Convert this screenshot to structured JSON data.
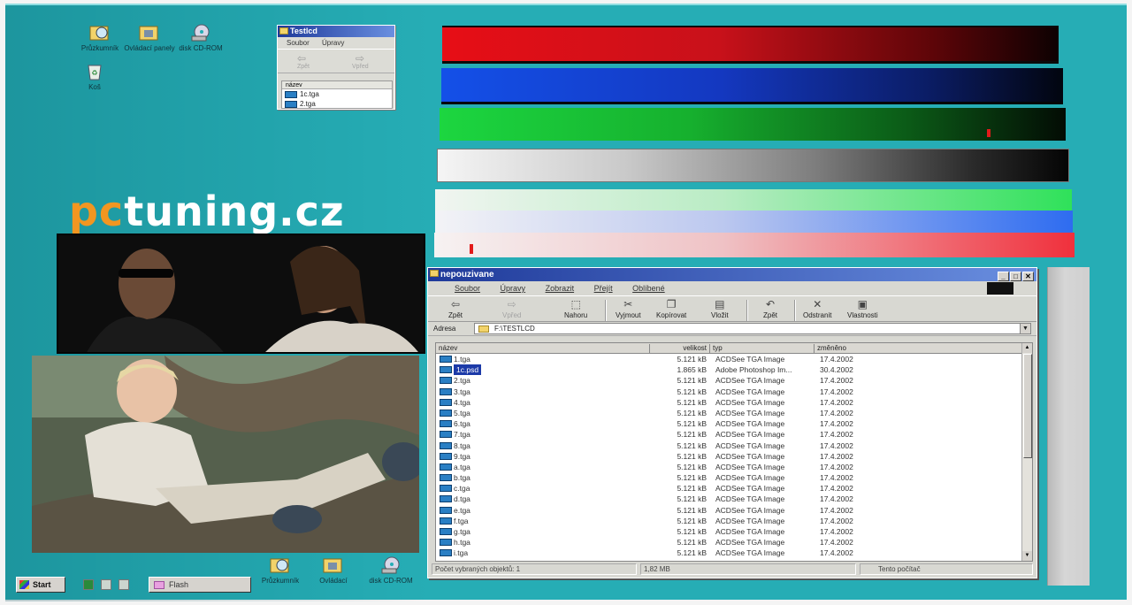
{
  "desktop_icons": {
    "pruzkumnik": "Průzkumník",
    "ovladaci_panely": "Ovládací panely",
    "disk_cdrom": "disk CD-ROM",
    "kos": "Koš"
  },
  "testlcd_window": {
    "title": "Testlcd",
    "menu": [
      "Soubor",
      "Úpravy"
    ],
    "toolbar": [
      "Zpět",
      "Vpřed"
    ],
    "column": "název",
    "files": [
      "1c.tga",
      "2.tga"
    ]
  },
  "brand": {
    "part1": "pc",
    "part2": "tuning.cz"
  },
  "explorer": {
    "title": "nepouzivane",
    "menu": [
      "Soubor",
      "Úpravy",
      "Zobrazit",
      "Přejít",
      "Oblíbené"
    ],
    "toolbar": {
      "back": "Zpět",
      "forward": "Vpřed",
      "up": "Nahoru",
      "cut": "Vyjmout",
      "copy": "Kopírovat",
      "paste": "Vložit",
      "undo": "Zpět",
      "delete": "Odstranit",
      "properties": "Vlastnosti"
    },
    "address_label": "Adresa",
    "address_value": "F:\\TESTLCD",
    "columns": {
      "name": "název",
      "size": "velikost",
      "type": "typ",
      "modified": "změněno"
    },
    "files": [
      {
        "name": "1.tga",
        "size": "5.121 kB",
        "type": "ACDSee TGA Image",
        "date": "17.4.2002"
      },
      {
        "name": "1c.psd",
        "size": "1.865 kB",
        "type": "Adobe Photoshop Im...",
        "date": "30.4.2002"
      },
      {
        "name": "2.tga",
        "size": "5.121 kB",
        "type": "ACDSee TGA Image",
        "date": "17.4.2002"
      },
      {
        "name": "3.tga",
        "size": "5.121 kB",
        "type": "ACDSee TGA Image",
        "date": "17.4.2002"
      },
      {
        "name": "4.tga",
        "size": "5.121 kB",
        "type": "ACDSee TGA Image",
        "date": "17.4.2002"
      },
      {
        "name": "5.tga",
        "size": "5.121 kB",
        "type": "ACDSee TGA Image",
        "date": "17.4.2002"
      },
      {
        "name": "6.tga",
        "size": "5.121 kB",
        "type": "ACDSee TGA Image",
        "date": "17.4.2002"
      },
      {
        "name": "7.tga",
        "size": "5.121 kB",
        "type": "ACDSee TGA Image",
        "date": "17.4.2002"
      },
      {
        "name": "8.tga",
        "size": "5.121 kB",
        "type": "ACDSee TGA Image",
        "date": "17.4.2002"
      },
      {
        "name": "9.tga",
        "size": "5.121 kB",
        "type": "ACDSee TGA Image",
        "date": "17.4.2002"
      },
      {
        "name": "a.tga",
        "size": "5.121 kB",
        "type": "ACDSee TGA Image",
        "date": "17.4.2002"
      },
      {
        "name": "b.tga",
        "size": "5.121 kB",
        "type": "ACDSee TGA Image",
        "date": "17.4.2002"
      },
      {
        "name": "c.tga",
        "size": "5.121 kB",
        "type": "ACDSee TGA Image",
        "date": "17.4.2002"
      },
      {
        "name": "d.tga",
        "size": "5.121 kB",
        "type": "ACDSee TGA Image",
        "date": "17.4.2002"
      },
      {
        "name": "e.tga",
        "size": "5.121 kB",
        "type": "ACDSee TGA Image",
        "date": "17.4.2002"
      },
      {
        "name": "f.tga",
        "size": "5.121 kB",
        "type": "ACDSee TGA Image",
        "date": "17.4.2002"
      },
      {
        "name": "g.tga",
        "size": "5.121 kB",
        "type": "ACDSee TGA Image",
        "date": "17.4.2002"
      },
      {
        "name": "h.tga",
        "size": "5.121 kB",
        "type": "ACDSee TGA Image",
        "date": "17.4.2002"
      },
      {
        "name": "i.tga",
        "size": "5.121 kB",
        "type": "ACDSee TGA Image",
        "date": "17.4.2002"
      }
    ],
    "selected_index": 1,
    "status": {
      "selected": "Počet vybraných objektů: 1",
      "size": "1,82 MB",
      "location": "Tento počítač"
    }
  },
  "taskbar": {
    "start": "Start",
    "task": "Flash",
    "pruzkumnik": "Průzkumník",
    "ovladaci": "Ovládací",
    "disk": "disk CD-ROM"
  },
  "colors": {
    "desktop": "#26adb5",
    "brand_orange": "#f29621",
    "titlebar": "#1f3a9a",
    "selection": "#1c3aa8"
  }
}
